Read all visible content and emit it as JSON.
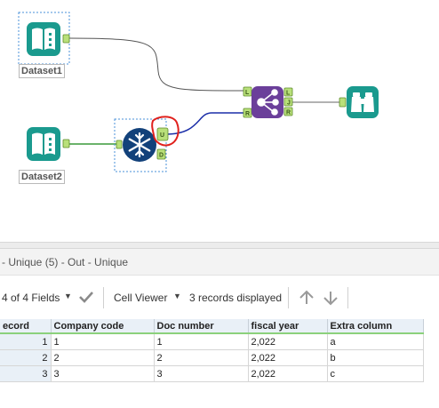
{
  "canvas": {
    "nodes": {
      "dataset1": {
        "label": "Dataset1"
      },
      "dataset2": {
        "label": "Dataset2"
      },
      "unique": {
        "anchors": {
          "unique": "U",
          "duplicates": "D"
        }
      },
      "join": {
        "anchors": {
          "left": "L",
          "right": "R",
          "out_left": "L",
          "out_join": "J",
          "out_right": "R"
        }
      }
    },
    "colors": {
      "input_teal": "#1a9a8e",
      "unique_blue": "#12417a",
      "join_purple": "#6b3f9a",
      "anchor_green": "#b9e07a",
      "annotation_red": "#e0201c",
      "connection_blue": "#1b2ea8"
    }
  },
  "results": {
    "title": "- Unique (5) - Out - Unique",
    "toolbar": {
      "fields_label": "4 of 4 Fields",
      "viewer_label": "Cell Viewer",
      "records_label": "3 records displayed"
    },
    "grid": {
      "columns": [
        "ecord",
        "Company code",
        "Doc number",
        "fiscal year",
        "Extra column"
      ],
      "rows": [
        {
          "record": "1",
          "company_code": "1",
          "doc_number": "1",
          "fiscal_year": "2,022",
          "extra": "a"
        },
        {
          "record": "2",
          "company_code": "2",
          "doc_number": "2",
          "fiscal_year": "2,022",
          "extra": "b"
        },
        {
          "record": "3",
          "company_code": "3",
          "doc_number": "3",
          "fiscal_year": "2,022",
          "extra": "c"
        }
      ]
    }
  }
}
